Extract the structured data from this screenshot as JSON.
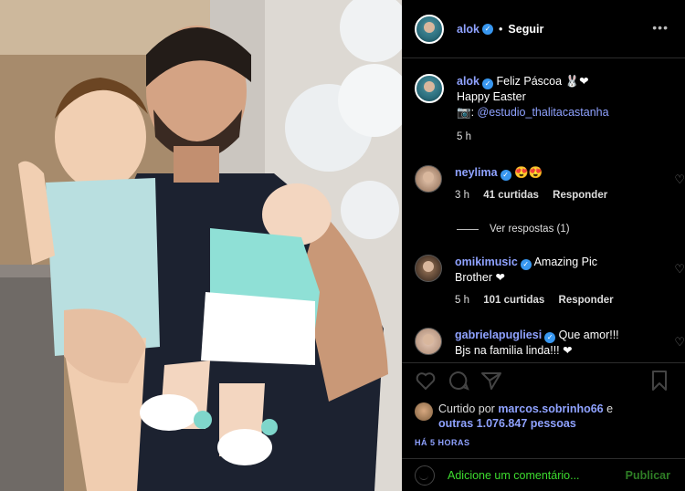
{
  "header": {
    "username": "alok",
    "separator": "•",
    "follow_label": "Seguir",
    "more_icon": "more-dots-icon"
  },
  "caption": {
    "username": "alok",
    "line1": "Feliz Páscoa 🐰❤",
    "line2": "Happy Easter",
    "credit_prefix": "📷: ",
    "credit_link": "@estudio_thalitacastanha",
    "time": "5 h"
  },
  "comments": [
    {
      "username": "neylima",
      "text": "😍😍",
      "time": "3 h",
      "likes": "41 curtidas",
      "reply": "Responder"
    },
    {
      "username": "omikimusic",
      "text": "Amazing Pic",
      "text2": "Brother ❤",
      "time": "5 h",
      "likes": "101 curtidas",
      "reply": "Responder"
    },
    {
      "username": "gabrielapugliesi",
      "text": "Que amor!!!",
      "text2": "Bjs na familia linda!!! ❤"
    }
  ],
  "view_replies": "Ver respostas (1)",
  "actions": [
    "heart-icon",
    "comment-icon",
    "share-icon",
    "bookmark-icon"
  ],
  "likes": {
    "prefix": "Curtido por ",
    "user": "marcos.sobrinho66",
    "mid": " e",
    "others": "outras 1.076.847 pessoas"
  },
  "post_time": "HÁ 5 HORAS",
  "add_comment": {
    "placeholder": "Adicione um comentário...",
    "publish_label": "Publicar"
  },
  "colors": {
    "username": "#8fa2ff",
    "verified": "#3897f0",
    "add_comment_text": "#3ddc2f",
    "publish": "#2e7d25"
  }
}
